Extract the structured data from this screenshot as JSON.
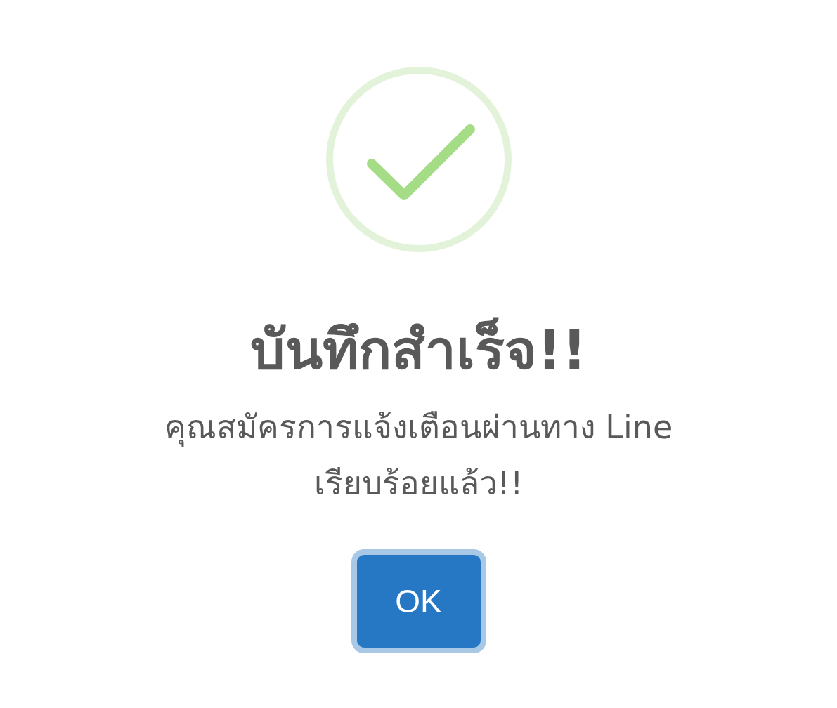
{
  "dialog": {
    "icon": {
      "kind": "success"
    },
    "title": "บันทึกสำเร็จ!!",
    "message": "คุณสมัครการแจ้งเตือนผ่านทาง Line เรียบร้อยแล้ว!!",
    "confirm_button": {
      "label": "OK",
      "focused": true
    }
  }
}
